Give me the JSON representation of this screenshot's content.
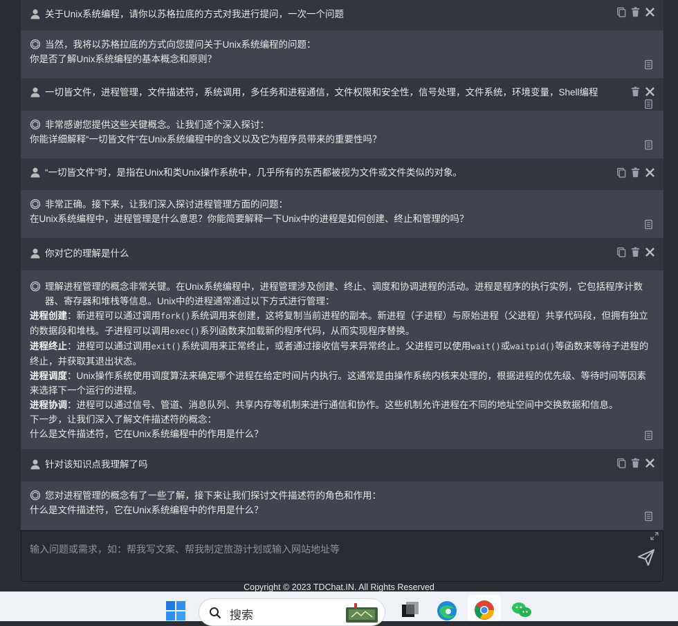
{
  "messages": [
    {
      "role": "user",
      "text": "关于Unix系统编程，请你以苏格拉底的方式对我进行提问，一次一个问题"
    },
    {
      "role": "bot",
      "lines": [
        "当然，我将以苏格拉底的方式向您提问关于Unix系统编程的问题：",
        "你是否了解Unix系统编程的基本概念和原则？"
      ]
    },
    {
      "role": "user",
      "text": "一切皆文件，进程管理，文件描述符，系统调用，多任务和进程通信，文件权限和安全性，信号处理，文件系统，环境变量，Shell编程"
    },
    {
      "role": "bot",
      "lines": [
        "非常感谢您提供这些关键概念。让我们逐个深入探讨：",
        "你能详细解释“一切皆文件”在Unix系统编程中的含义以及它为程序员带来的重要性吗？"
      ]
    },
    {
      "role": "user",
      "text": "“一切皆文件”时，是指在Unix和类Unix操作系统中，几乎所有的东西都被视为文件或文件类似的对象。"
    },
    {
      "role": "bot",
      "lines": [
        "非常正确。接下来，让我们深入探讨进程管理方面的问题：",
        "在Unix系统编程中，进程管理是什么意思？你能简要解释一下Unix中的进程是如何创建、终止和管理的吗？"
      ]
    },
    {
      "role": "user",
      "text": "你对它的理解是什么"
    },
    {
      "role": "bot",
      "intro": "理解进程管理的概念非常关键。在Unix系统编程中，进程管理涉及创建、终止、调度和协调进程的活动。进程是程序的执行实例，它包括程序计数器、寄存器和堆栈等信息。Unix中的进程通常通过以下方式进行管理：",
      "items": [
        {
          "label": "进程创建",
          "parts": [
            "：新进程可以通过调用",
            "fork()",
            "系统调用来创建，这将复制当前进程的副本。新进程（子进程）与原始进程（父进程）共享代码段，但拥有独立的数据段和堆栈。子进程可以调用",
            "exec()",
            "系列函数来加载新的程序代码，从而实现程序替换。"
          ]
        },
        {
          "label": "进程终止",
          "parts": [
            "：进程可以通过调用",
            "exit()",
            "系统调用来正常终止，或者通过接收信号来异常终止。父进程可以使用",
            "wait()",
            "或",
            "waitpid()",
            "等函数来等待子进程的终止，并获取其退出状态。"
          ]
        },
        {
          "label": "进程调度",
          "parts": [
            "：Unix操作系统使用调度算法来确定哪个进程在给定时间片内执行。这通常是由操作系统内核来处理的，根据进程的优先级、等待时间等因素来选择下一个运行的进程。"
          ]
        },
        {
          "label": "进程协调",
          "parts": [
            "：进程可以通过信号、管道、消息队列、共享内存等机制来进行通信和协作。这些机制允许进程在不同的地址空间中交换数据和信息。"
          ]
        }
      ],
      "outro": [
        "下一步，让我们深入了解文件描述符的概念：",
        "什么是文件描述符，它在Unix系统编程中的作用是什么？"
      ]
    },
    {
      "role": "user",
      "text": "针对该知识点我理解了吗"
    },
    {
      "role": "bot",
      "lines": [
        "您对进程管理的概念有了一些了解，接下来让我们探讨文件描述符的角色和作用：",
        "什么是文件描述符，它在Unix系统编程中的作用是什么？"
      ]
    }
  ],
  "input": {
    "placeholder": "输入问题或需求，如：帮我写文案、帮我制定旅游计划或输入网站地址等"
  },
  "footer": {
    "copyright": "Copyright © 2023 TDChat.IN. All Rights Reserved"
  },
  "taskbar": {
    "search_label": "搜索"
  },
  "colors": {
    "user_bg": "#33353f",
    "bot_bg": "#41444f",
    "page_bg": "#2b2d35"
  }
}
